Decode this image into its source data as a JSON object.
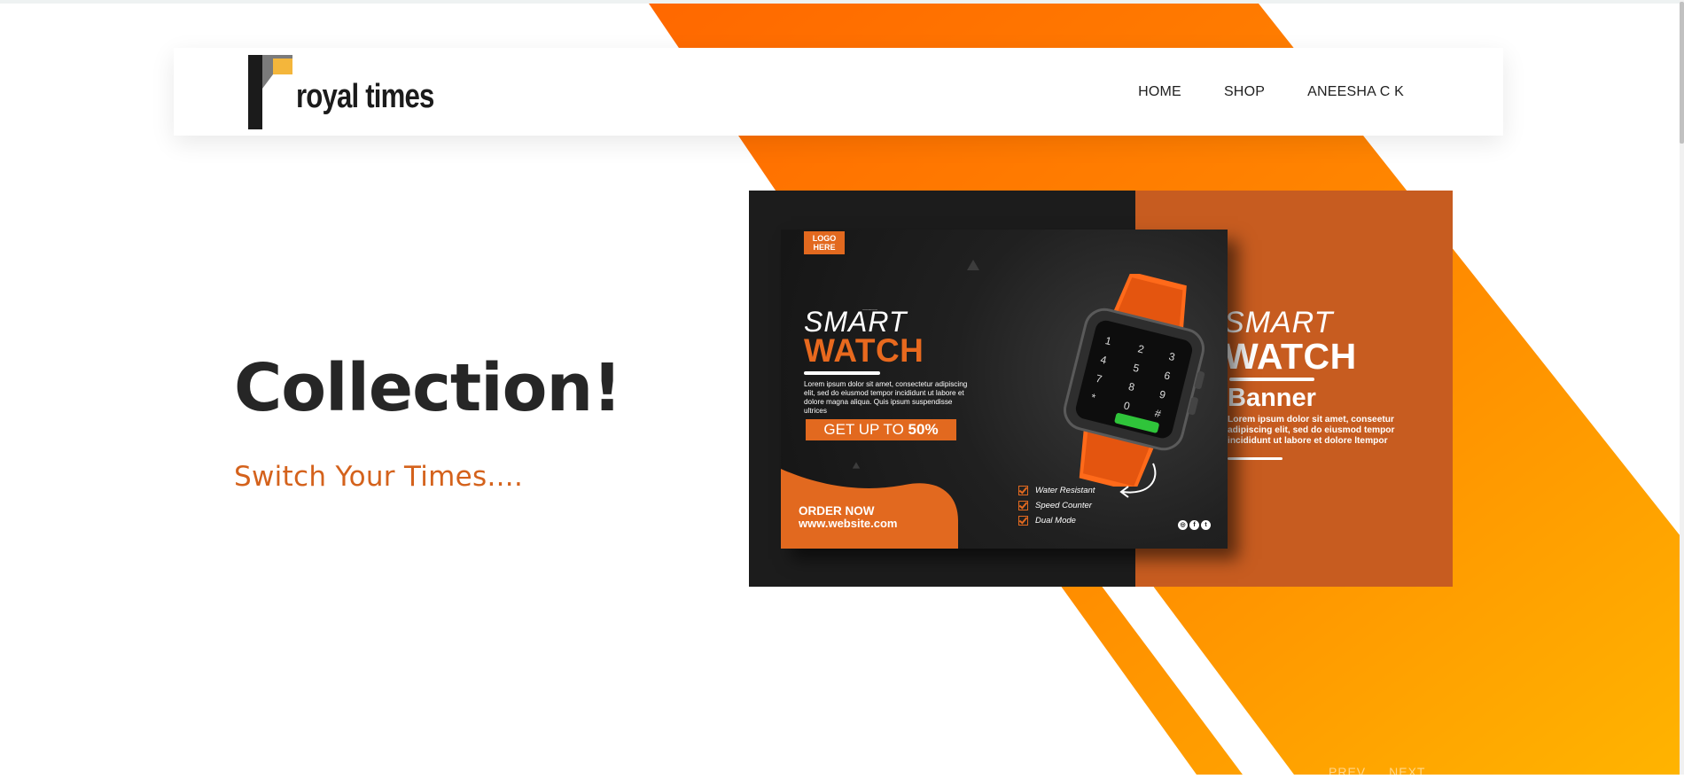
{
  "header": {
    "brand_name": "royal times",
    "nav": [
      {
        "label": "HOME"
      },
      {
        "label": "SHOP"
      },
      {
        "label": "ANEESHA C K"
      }
    ]
  },
  "hero": {
    "title": "Collection!",
    "subtitle": "Switch Your Times...."
  },
  "banner": {
    "logo_placeholder": "LOGO HERE",
    "left_card": {
      "smart": "SMART",
      "watch": "WATCH",
      "description": "Lorem ipsum dolor sit amet, consectetur adipiscing elit, sed do eiusmod tempor incididunt ut labore et dolore magna aliqua. Quis ipsum suspendisse ultrices",
      "offer_prefix": "GET UP TO",
      "offer_value": "50%",
      "order_title": "ORDER NOW",
      "order_site": "www.website.com",
      "features": [
        "Water Resistant",
        "Speed Counter",
        "Dual Mode"
      ]
    },
    "right_panel": {
      "smart": "SMART",
      "watch": "WATCH",
      "banner_word": "Banner",
      "description": "Lorem ipsum dolor sit amet, conseetur adipiscing elit, sed do eiusmod tempor incididunt ut labore et dolore ltempor"
    }
  },
  "slider": {
    "prev": "PREV",
    "next": "NEXT"
  },
  "colors": {
    "accent": "#e2691f",
    "subtitle": "#d4621c",
    "banner_right": "#c75c20",
    "stripe_orange": "#ff6a00",
    "stripe_yellow": "#ffb300"
  }
}
